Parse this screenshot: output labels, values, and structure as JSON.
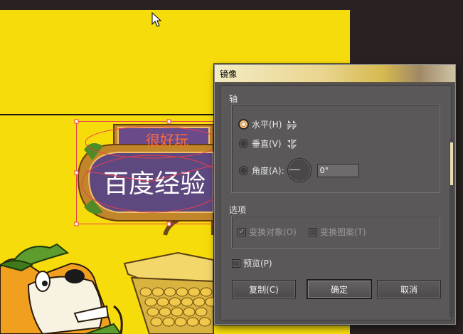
{
  "canvas": {
    "badge_small_text": "很好玩",
    "badge_big_text": "百度经验"
  },
  "dialog": {
    "title": "镜像",
    "axis_group": {
      "label": "轴",
      "options": [
        {
          "label": "水平(H)",
          "selected": true,
          "icon": "mirror-horizontal-icon"
        },
        {
          "label": "垂直(V)",
          "selected": false,
          "icon": "mirror-vertical-icon"
        }
      ],
      "angle": {
        "label": "角度(A):",
        "value": "0°",
        "selected": false
      }
    },
    "options_group": {
      "label": "选项",
      "transform_objects": {
        "label": "变换对象(O)",
        "checked": true,
        "disabled": true
      },
      "transform_patterns": {
        "label": "变换图案(T)",
        "checked": false,
        "disabled": true
      }
    },
    "preview": {
      "label": "预览(P)",
      "checked": false
    },
    "buttons": {
      "copy": "复制(C)",
      "ok": "确定",
      "cancel": "取消"
    }
  }
}
